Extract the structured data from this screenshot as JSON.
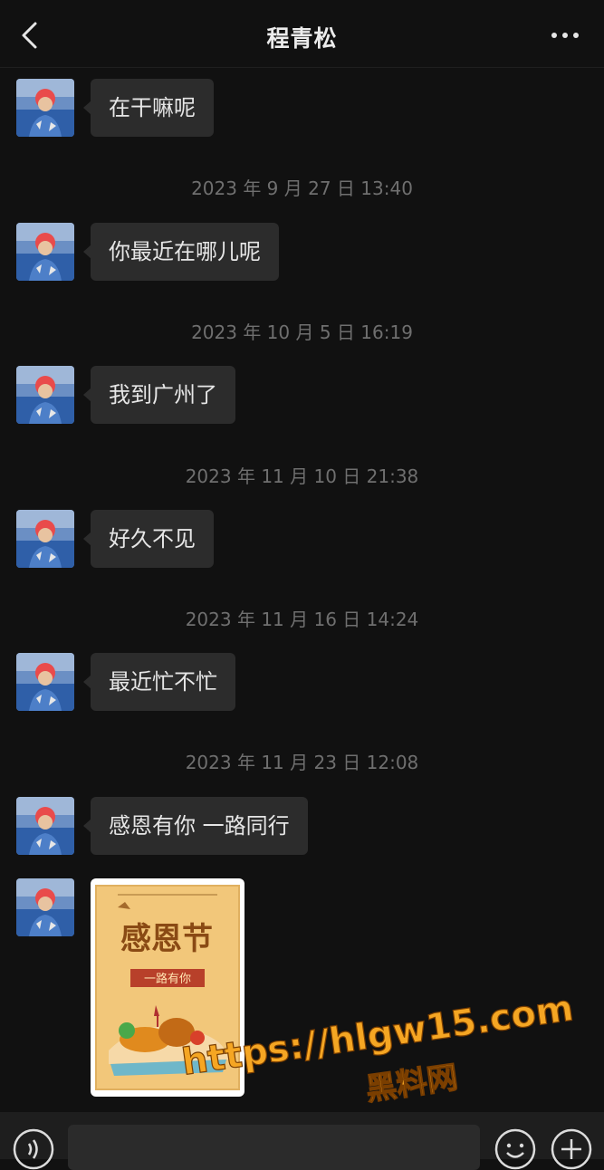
{
  "header": {
    "title": "程青松",
    "back_icon": "chevron-left-icon",
    "more_icon": "more-dots-icon"
  },
  "messages": [
    {
      "type": "text",
      "text": "在干嘛呢"
    },
    {
      "type": "timestamp",
      "text": "2023 年 9 月 27 日 13:40"
    },
    {
      "type": "text",
      "text": "你最近在哪儿呢"
    },
    {
      "type": "timestamp",
      "text": "2023 年 10 月 5 日 16:19"
    },
    {
      "type": "text",
      "text": "我到广州了"
    },
    {
      "type": "timestamp",
      "text": "2023 年 11 月 10 日 21:38"
    },
    {
      "type": "text",
      "text": "好久不见"
    },
    {
      "type": "timestamp",
      "text": "2023 年 11 月 16 日 14:24"
    },
    {
      "type": "text",
      "text": "最近忙不忙"
    },
    {
      "type": "timestamp",
      "text": "2023 年 11 月 23 日 12:08"
    },
    {
      "type": "text",
      "text": "感恩有你 一路同行"
    },
    {
      "type": "image",
      "alt_title": "感恩节",
      "alt_subtitle": "一路有你"
    }
  ],
  "watermark": {
    "line1": "https://hlgw15.com",
    "line2": "黑料网"
  },
  "input_bar": {
    "voice_icon": "voice-icon",
    "emoji_icon": "emoji-icon",
    "plus_icon": "plus-icon"
  },
  "colors": {
    "background": "#111111",
    "bubble": "#2c2c2c",
    "timestamp": "#6f6f6f",
    "watermark": "#f5a623"
  }
}
